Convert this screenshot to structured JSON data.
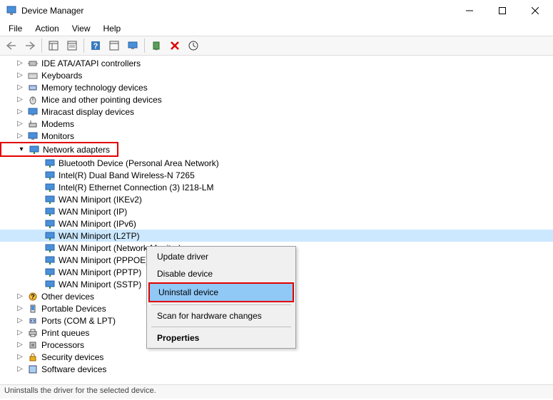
{
  "window": {
    "title": "Device Manager"
  },
  "menu": {
    "file": "File",
    "action": "Action",
    "view": "View",
    "help": "Help"
  },
  "categories": {
    "ide": "IDE ATA/ATAPI controllers",
    "keyboards": "Keyboards",
    "memory": "Memory technology devices",
    "mice": "Mice and other pointing devices",
    "miracast": "Miracast display devices",
    "modems": "Modems",
    "monitors": "Monitors",
    "network": "Network adapters",
    "other": "Other devices",
    "portable": "Portable Devices",
    "ports": "Ports (COM & LPT)",
    "printqueues": "Print queues",
    "processors": "Processors",
    "security": "Security devices",
    "software": "Software devices"
  },
  "network_adapters": {
    "bt": "Bluetooth Device (Personal Area Network)",
    "wifi": "Intel(R) Dual Band Wireless-N 7265",
    "eth": "Intel(R) Ethernet Connection (3) I218-LM",
    "ikev2": "WAN Miniport (IKEv2)",
    "ip": "WAN Miniport (IP)",
    "ipv6": "WAN Miniport (IPv6)",
    "l2tp": "WAN Miniport (L2TP)",
    "netmon": "WAN Miniport (Network Monitor)",
    "pppoe": "WAN Miniport (PPPOE)",
    "pptp": "WAN Miniport (PPTP)",
    "sstp": "WAN Miniport (SSTP)"
  },
  "context_menu": {
    "update": "Update driver",
    "disable": "Disable device",
    "uninstall": "Uninstall device",
    "scan": "Scan for hardware changes",
    "properties": "Properties"
  },
  "statusbar": "Uninstalls the driver for the selected device."
}
